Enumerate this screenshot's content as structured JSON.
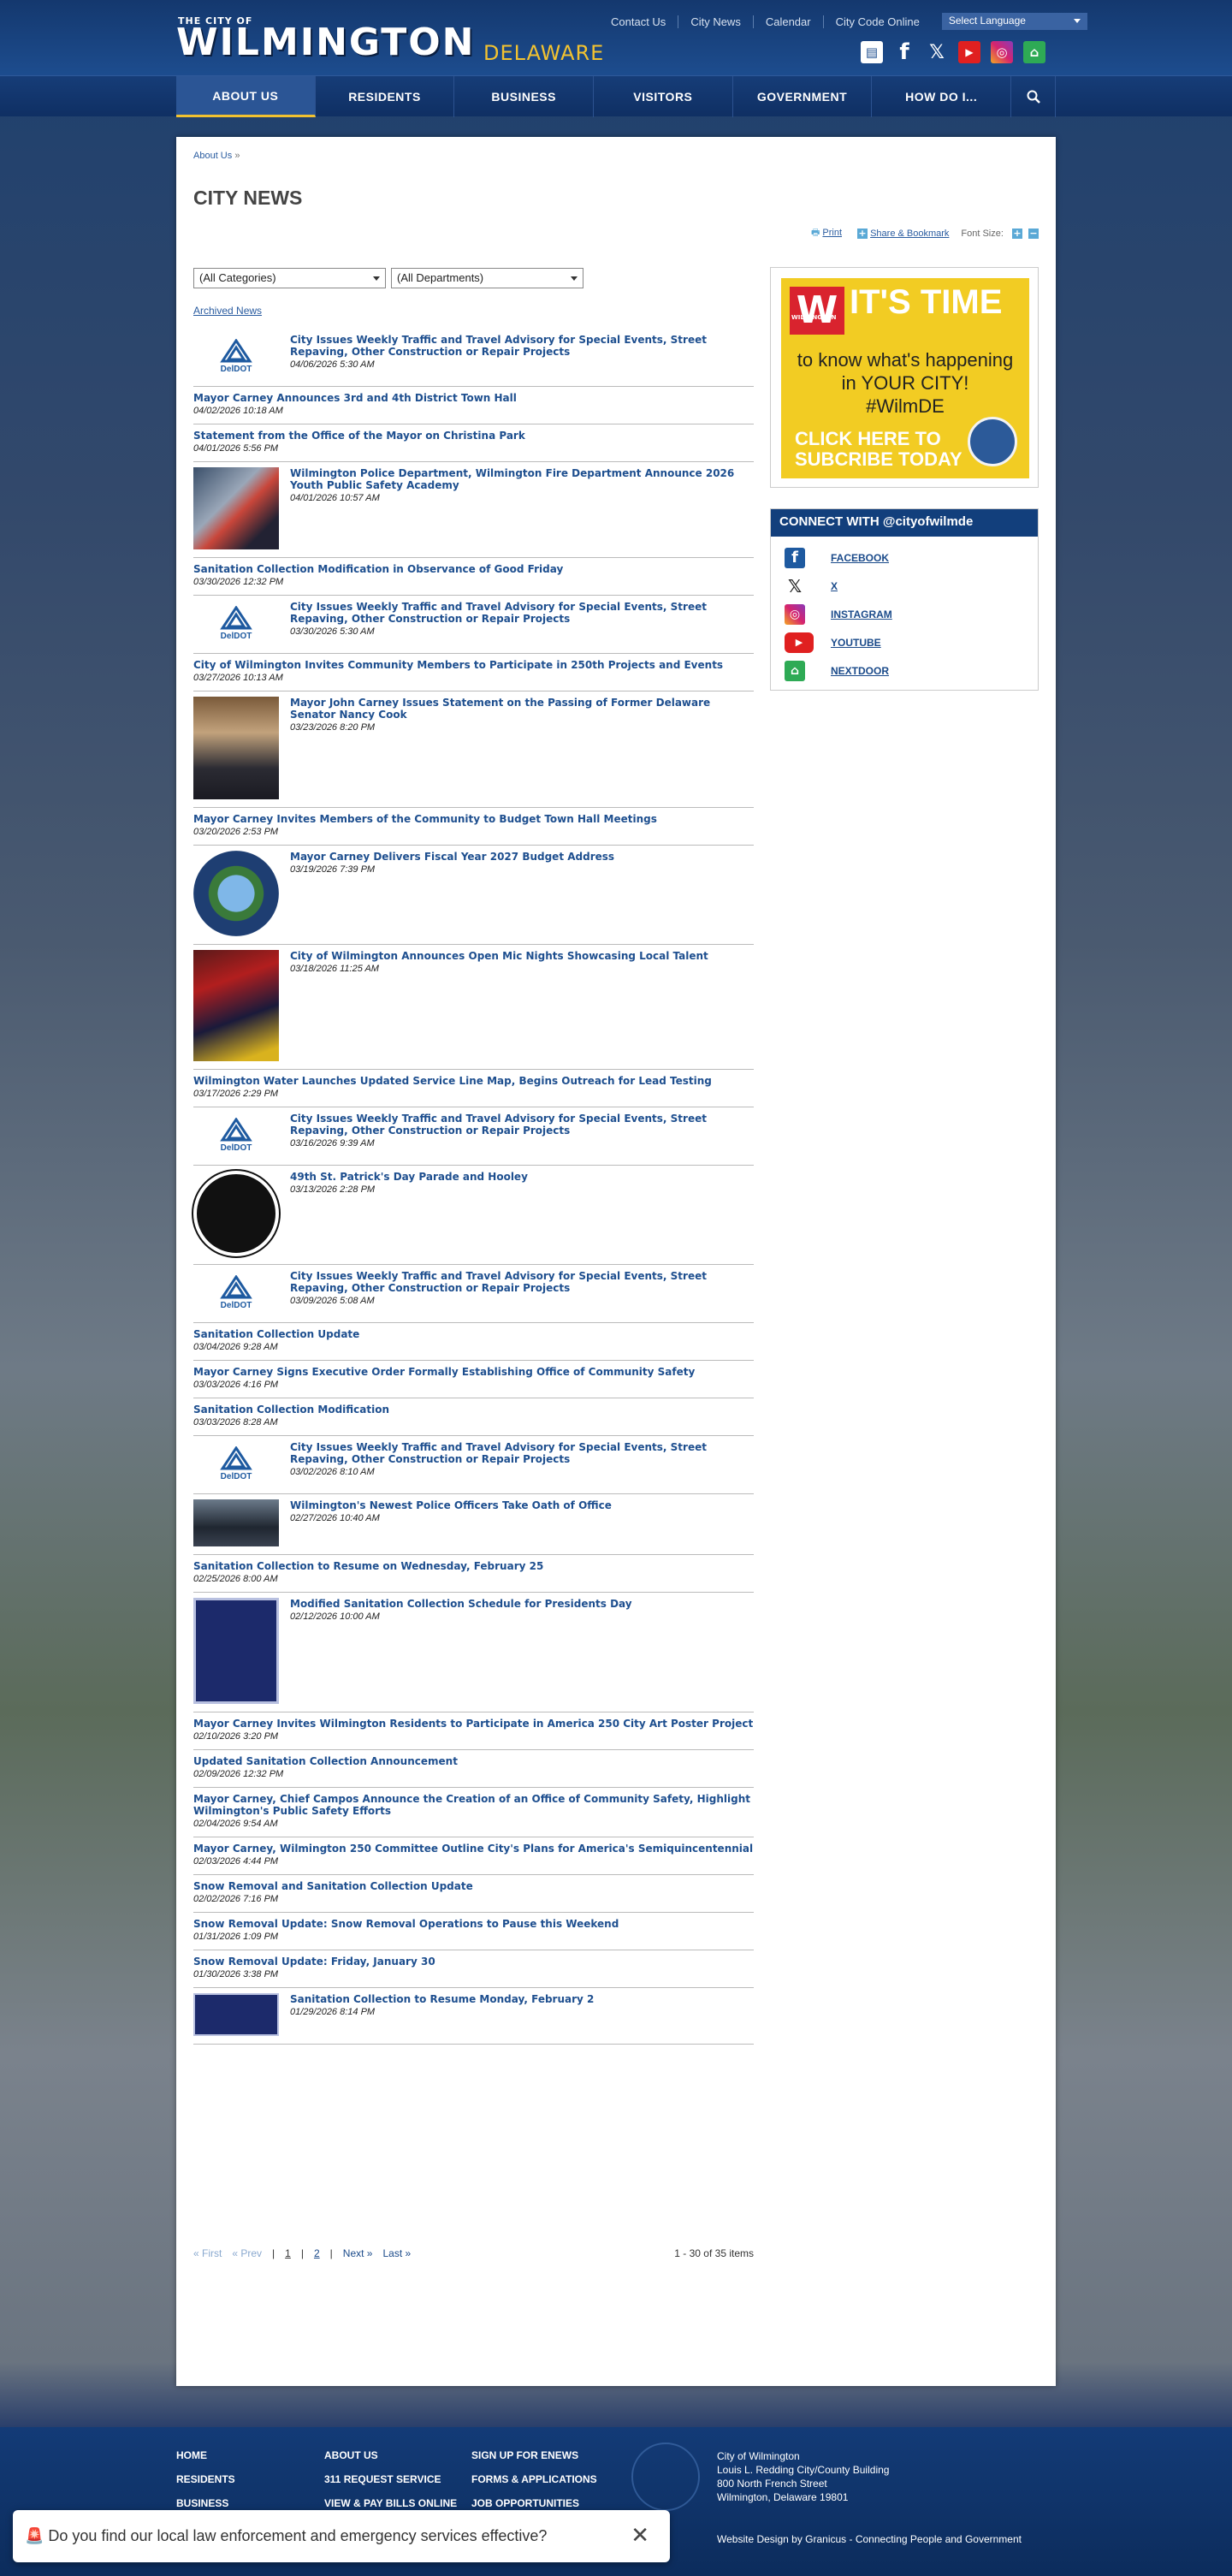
{
  "header": {
    "logo_top": "THE CITY OF",
    "logo_main": "WILMINGTON",
    "logo_sub": "DELAWARE",
    "util_links": [
      "Contact Us",
      "City News",
      "Calendar",
      "City Code Online"
    ],
    "language_select": "Select Language",
    "social_icons": [
      "news-icon",
      "facebook-icon",
      "x-icon",
      "youtube-icon",
      "instagram-icon",
      "nextdoor-icon"
    ]
  },
  "nav": {
    "items": [
      "ABOUT US",
      "RESIDENTS",
      "BUSINESS",
      "VISITORS",
      "GOVERNMENT",
      "HOW DO I..."
    ],
    "active": "ABOUT US",
    "search_icon": "search-icon"
  },
  "breadcrumb": {
    "link": "About Us",
    "separator": "»"
  },
  "page_title": "CITY NEWS",
  "tools": {
    "print": "Print",
    "share": "Share & Bookmark",
    "font_size": "Font Size:",
    "increase": "+",
    "decrease": "−"
  },
  "filters": {
    "categories": "(All Categories)",
    "departments": "(All Departments)"
  },
  "archived_link": "Archived News",
  "news": [
    {
      "title": "City Issues Weekly Traffic and Travel Advisory for Special Events, Street Repaving, Other Construction or Repair Projects",
      "date": "04/06/2026 5:30 AM",
      "thumb": "deldot"
    },
    {
      "title": "Mayor Carney Announces 3rd and 4th District Town Hall",
      "date": "04/02/2026 10:18 AM",
      "thumb": ""
    },
    {
      "title": "Statement from the Office of the Mayor on Christina Park",
      "date": "04/01/2026 5:56 PM",
      "thumb": ""
    },
    {
      "title": "Wilmington Police Department, Wilmington Fire Department Announce 2026 Youth Public Safety Academy",
      "date": "04/01/2026 10:57 AM",
      "thumb": "photo-collage"
    },
    {
      "title": "Sanitation Collection Modification in Observance of Good Friday",
      "date": "03/30/2026 12:32 PM",
      "thumb": ""
    },
    {
      "title": "City Issues Weekly Traffic and Travel Advisory for Special Events, Street Repaving, Other Construction or Repair Projects",
      "date": "03/30/2026 5:30 AM",
      "thumb": "deldot"
    },
    {
      "title": "City of Wilmington Invites Community Members to Participate in 250th Projects and Events",
      "date": "03/27/2026 10:13 AM",
      "thumb": ""
    },
    {
      "title": "Mayor John Carney Issues Statement on the Passing of Former Delaware Senator Nancy Cook",
      "date": "03/23/2026 8:20 PM",
      "thumb": "portrait"
    },
    {
      "title": "Mayor Carney Invites Members of the Community to Budget Town Hall Meetings",
      "date": "03/20/2026 2:53 PM",
      "thumb": ""
    },
    {
      "title": "Mayor Carney Delivers Fiscal Year 2027 Budget Address",
      "date": "03/19/2026 7:39 PM",
      "thumb": "city-seal"
    },
    {
      "title": "City of Wilmington Announces Open Mic Nights Showcasing Local Talent",
      "date": "03/18/2026 11:25 AM",
      "thumb": "flyer"
    },
    {
      "title": "Wilmington Water Launches Updated Service Line Map, Begins Outreach for Lead Testing",
      "date": "03/17/2026 2:29 PM",
      "thumb": ""
    },
    {
      "title": "City Issues Weekly Traffic and Travel Advisory for Special Events, Street Repaving, Other Construction or Repair Projects",
      "date": "03/16/2026 9:39 AM",
      "thumb": "deldot"
    },
    {
      "title": "49th St. Patrick's Day Parade and Hooley",
      "date": "03/13/2026 2:28 PM",
      "thumb": "badge"
    },
    {
      "title": "City Issues Weekly Traffic and Travel Advisory for Special Events, Street Repaving, Other Construction or Repair Projects",
      "date": "03/09/2026 5:08 AM",
      "thumb": "deldot"
    },
    {
      "title": "Sanitation Collection Update",
      "date": "03/04/2026 9:28 AM",
      "thumb": ""
    },
    {
      "title": "Mayor Carney Signs Executive Order Formally Establishing Office of Community Safety",
      "date": "03/03/2026 4:16 PM",
      "thumb": ""
    },
    {
      "title": "Sanitation Collection Modification",
      "date": "03/03/2026 8:28 AM",
      "thumb": ""
    },
    {
      "title": "City Issues Weekly Traffic and Travel Advisory for Special Events, Street Repaving, Other Construction or Repair Projects",
      "date": "03/02/2026 8:10 AM",
      "thumb": "deldot"
    },
    {
      "title": "Wilmington's Newest Police Officers Take Oath of Office",
      "date": "02/27/2026 10:40 AM",
      "thumb": "group-photo"
    },
    {
      "title": "Sanitation Collection to Resume on Wednesday, February 25",
      "date": "02/25/2026 8:00 AM",
      "thumb": ""
    },
    {
      "title": "Modified Sanitation Collection Schedule for Presidents Day",
      "date": "02/12/2026 10:00 AM",
      "thumb": "schedule"
    },
    {
      "title": "Mayor Carney Invites Wilmington Residents to Participate in America 250 City Art Poster Project",
      "date": "02/10/2026 3:20 PM",
      "thumb": ""
    },
    {
      "title": "Updated Sanitation Collection Announcement",
      "date": "02/09/2026 12:32 PM",
      "thumb": ""
    },
    {
      "title": "Mayor Carney, Chief Campos Announce the Creation of an Office of Community Safety, Highlight Wilmington's Public Safety Efforts",
      "date": "02/04/2026 9:54 AM",
      "thumb": ""
    },
    {
      "title": "Mayor Carney, Wilmington 250 Committee Outline City's Plans for America's Semiquincentennial",
      "date": "02/03/2026 4:44 PM",
      "thumb": ""
    },
    {
      "title": "Snow Removal and Sanitation Collection Update",
      "date": "02/02/2026 7:16 PM",
      "thumb": ""
    },
    {
      "title": "Snow Removal Update: Snow Removal Operations to Pause this Weekend",
      "date": "01/31/2026 1:09 PM",
      "thumb": ""
    },
    {
      "title": "Snow Removal Update: Friday, January 30",
      "date": "01/30/2026 3:38 PM",
      "thumb": ""
    },
    {
      "title": "Sanitation Collection to Resume Monday, February 2",
      "date": "01/29/2026 8:14 PM",
      "thumb": "notice"
    }
  ],
  "pager": {
    "first": "« First",
    "prev": "« Prev",
    "pages": [
      "1",
      "2"
    ],
    "next": "Next »",
    "last": "Last »",
    "count": "1 - 30 of 35 items"
  },
  "sidebar": {
    "promo": {
      "w": "W",
      "wilmington": "WILMINGTON",
      "headline": "IT'S TIME",
      "line1": "to know what's happening",
      "line2": "in YOUR CITY!",
      "line3": "#WilmDE",
      "cta1": "CLICK HERE TO",
      "cta2": "SUBCRIBE TODAY"
    },
    "connect_title": "CONNECT WITH @cityofwilmde",
    "connect": [
      "FACEBOOK",
      "X",
      "INSTAGRAM",
      "YOUTUBE",
      "NEXTDOOR"
    ]
  },
  "footer": {
    "col1": [
      "HOME",
      "RESIDENTS",
      "BUSINESS"
    ],
    "col2": [
      "ABOUT US",
      "311 REQUEST SERVICE",
      "VIEW & PAY BILLS ONLINE"
    ],
    "col3": [
      "SIGN UP FOR ENEWS",
      "FORMS & APPLICATIONS",
      "JOB OPPORTUNITIES"
    ],
    "address": [
      "City of Wilmington",
      "Louis L. Redding City/County Building",
      "800 North French Street",
      "Wilmington, Delaware 19801"
    ],
    "credit": "Website Design by Granicus - Connecting People and Government"
  },
  "survey": {
    "text": "🚨 Do you find our local law enforcement and emergency services effective?",
    "close": "✕"
  },
  "colors": {
    "brand_blue": "#14386e",
    "gold": "#f2c230",
    "link": "#1e4f8f"
  }
}
